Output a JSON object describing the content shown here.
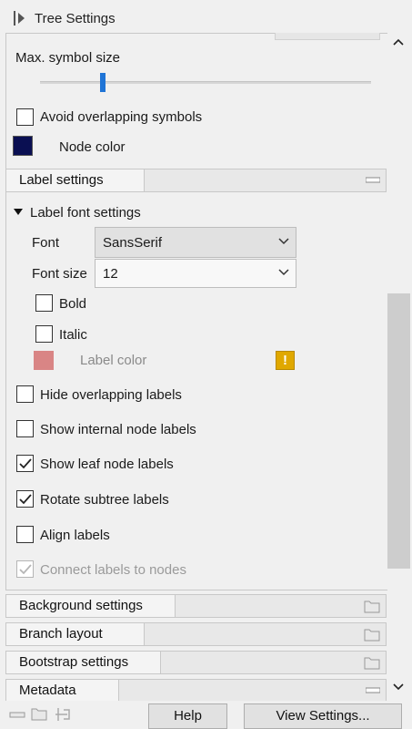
{
  "panel": {
    "title": "Tree Settings"
  },
  "symbols": {
    "max_symbol_size_label": "Max. symbol size",
    "slider_value": 0.19,
    "avoid_overlap_label": "Avoid overlapping symbols",
    "avoid_overlap_checked": false,
    "node_color_label": "Node color",
    "node_color": "#0a0f52"
  },
  "label_settings": {
    "header": "Label settings",
    "font_group_label": "Label font settings",
    "font_label": "Font",
    "font_value": "SansSerif",
    "font_size_label": "Font size",
    "font_size_value": "12",
    "bold_label": "Bold",
    "italic_label": "Italic",
    "label_color_label": "Label color",
    "label_color": "#d98585",
    "warning_glyph": "!",
    "options": [
      {
        "label": "Hide overlapping labels",
        "checked": false,
        "enabled": true
      },
      {
        "label": "Show internal node labels",
        "checked": false,
        "enabled": true
      },
      {
        "label": "Show leaf node labels",
        "checked": true,
        "enabled": true
      },
      {
        "label": "Rotate subtree labels",
        "checked": true,
        "enabled": true
      },
      {
        "label": "Align labels",
        "checked": false,
        "enabled": true
      },
      {
        "label": "Connect labels to nodes",
        "checked": true,
        "enabled": false
      }
    ]
  },
  "sections": [
    {
      "label": "Background settings",
      "icon": "folder-icon"
    },
    {
      "label": "Branch layout",
      "icon": "folder-icon"
    },
    {
      "label": "Bootstrap settings",
      "icon": "folder-icon"
    },
    {
      "label": "Metadata",
      "icon": "minimize-icon"
    }
  ],
  "footer": {
    "help_label": "Help",
    "view_settings_label": "View Settings..."
  },
  "colors": {
    "accent": "#1f74d6",
    "warning": "#e0a800"
  }
}
